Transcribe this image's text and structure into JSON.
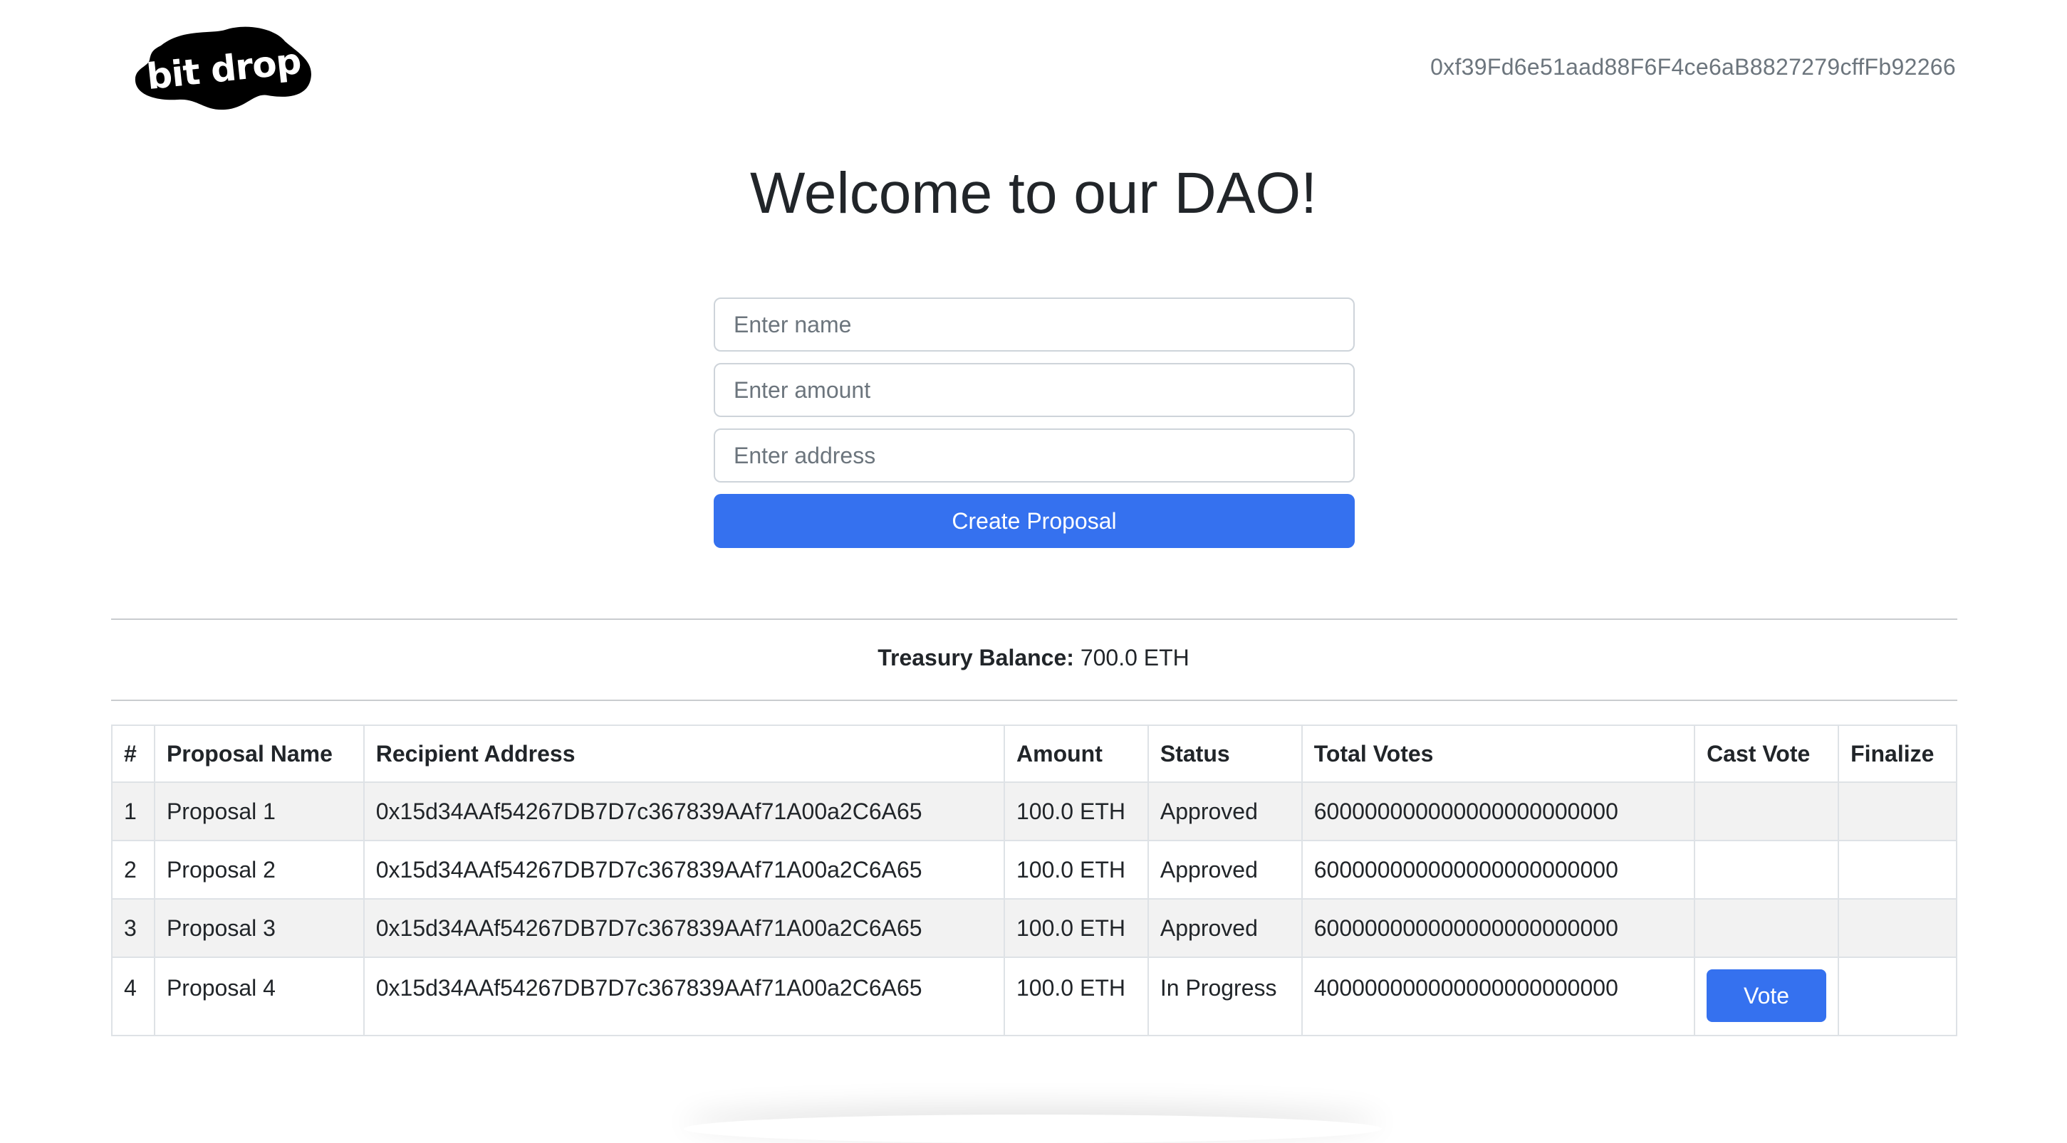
{
  "app": {
    "logo_text": "bit drop",
    "wallet_address": "0xf39Fd6e51aad88F6F4ce6aB8827279cffFb92266"
  },
  "hero": {
    "title": "Welcome to our DAO!"
  },
  "form": {
    "name_placeholder": "Enter name",
    "amount_placeholder": "Enter amount",
    "address_placeholder": "Enter address",
    "name_value": "",
    "amount_value": "",
    "address_value": "",
    "create_label": "Create Proposal"
  },
  "treasury": {
    "label": "Treasury Balance:",
    "value": "700.0 ETH"
  },
  "table": {
    "headers": {
      "index": "#",
      "name": "Proposal Name",
      "recipient": "Recipient Address",
      "amount": "Amount",
      "status": "Status",
      "votes": "Total Votes",
      "cast": "Cast Vote",
      "finalize": "Finalize"
    },
    "rows": [
      {
        "index": "1",
        "name": "Proposal 1",
        "recipient": "0x15d34AAf54267DB7D7c367839AAf71A00a2C6A65",
        "amount": "100.0 ETH",
        "status": "Approved",
        "votes": "600000000000000000000000"
      },
      {
        "index": "2",
        "name": "Proposal 2",
        "recipient": "0x15d34AAf54267DB7D7c367839AAf71A00a2C6A65",
        "amount": "100.0 ETH",
        "status": "Approved",
        "votes": "600000000000000000000000"
      },
      {
        "index": "3",
        "name": "Proposal 3",
        "recipient": "0x15d34AAf54267DB7D7c367839AAf71A00a2C6A65",
        "amount": "100.0 ETH",
        "status": "Approved",
        "votes": "600000000000000000000000"
      },
      {
        "index": "4",
        "name": "Proposal 4",
        "recipient": "0x15d34AAf54267DB7D7c367839AAf71A00a2C6A65",
        "amount": "100.0 ETH",
        "status": "In Progress",
        "votes": "400000000000000000000000",
        "vote_label": "Vote"
      }
    ]
  },
  "colors": {
    "primary": "#3571ef",
    "row_stripe": "#f2f2f2",
    "muted_text": "#6c757d"
  }
}
